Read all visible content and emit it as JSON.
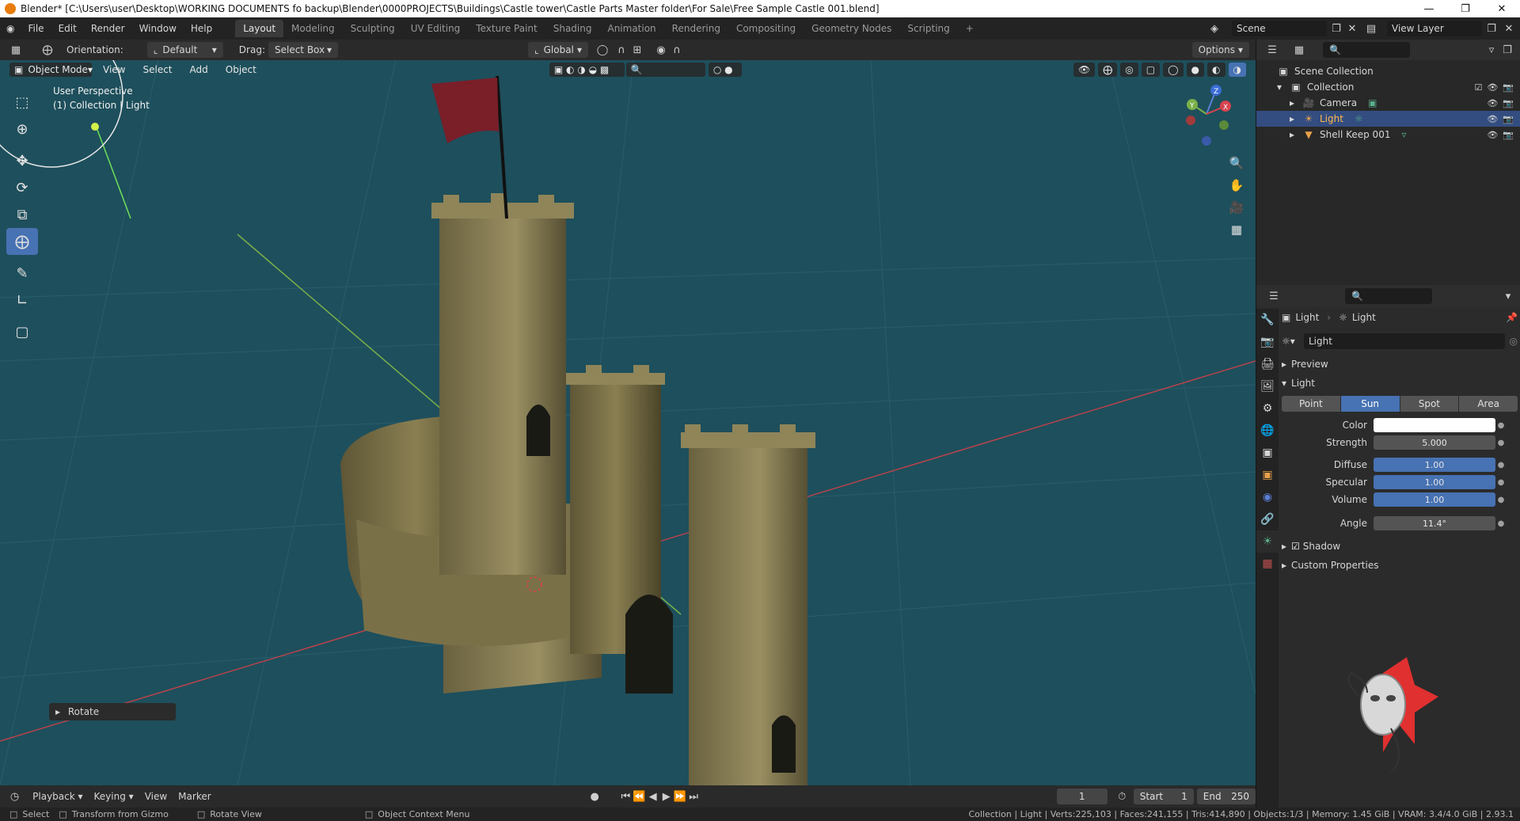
{
  "window": {
    "title": "Blender* [C:\\Users\\user\\Desktop\\WORKING DOCUMENTS fo backup\\Blender\\0000PROJECTS\\Buildings\\Castle tower\\Castle Parts Master folder\\For Sale\\Free Sample Castle 001.blend]"
  },
  "menu": [
    "File",
    "Edit",
    "Render",
    "Window",
    "Help"
  ],
  "workspaces": [
    "Layout",
    "Modeling",
    "Sculpting",
    "UV Editing",
    "Texture Paint",
    "Shading",
    "Animation",
    "Rendering",
    "Compositing",
    "Geometry Nodes",
    "Scripting"
  ],
  "active_workspace": "Layout",
  "scene": {
    "name": "Scene",
    "view_layer": "View Layer"
  },
  "header": {
    "orientation_label": "Orientation:",
    "orientation_value": "Default",
    "drag_label": "Drag:",
    "drag_value": "Select Box",
    "transform_orientation": "Global",
    "options": "Options"
  },
  "viewport": {
    "mode": "Object Mode",
    "menus": [
      "View",
      "Select",
      "Add",
      "Object"
    ],
    "info_line1": "User Perspective",
    "info_line2": "(1) Collection | Light",
    "gizmo_axes": [
      "Z",
      "Y",
      "X"
    ],
    "last_op": "Rotate"
  },
  "timeline": {
    "playback": "Playback",
    "keying": "Keying",
    "view": "View",
    "marker": "Marker",
    "current_frame": "1",
    "start_label": "Start",
    "start": "1",
    "end_label": "End",
    "end": "250"
  },
  "statusbar": {
    "select": "Select",
    "transform": "Transform from Gizmo",
    "rotate_view": "Rotate View",
    "context_menu": "Object Context Menu",
    "stats": "Collection | Light | Verts:225,103 | Faces:241,155 | Tris:414,890 | Objects:1/3 | Memory: 1.45 GiB | VRAM: 3.4/4.0 GiB | 2.93.1"
  },
  "outliner": {
    "scene_collection": "Scene Collection",
    "collection": "Collection",
    "items": [
      {
        "name": "Camera",
        "icon": "camera-icon",
        "color": "#e8a14a"
      },
      {
        "name": "Light",
        "icon": "light-icon",
        "color": "#e8a14a"
      },
      {
        "name": "Shell Keep 001",
        "icon": "mesh-icon",
        "color": "#e8a14a"
      }
    ]
  },
  "properties": {
    "breadcrumb_object": "Light",
    "breadcrumb_data": "Light",
    "datablock_name": "Light",
    "preview_section": "Preview",
    "light_section": "Light",
    "light_types": [
      "Point",
      "Sun",
      "Spot",
      "Area"
    ],
    "active_type": "Sun",
    "fields": {
      "color_label": "Color",
      "strength_label": "Strength",
      "strength": "5.000",
      "diffuse_label": "Diffuse",
      "diffuse": "1.00",
      "specular_label": "Specular",
      "specular": "1.00",
      "volume_label": "Volume",
      "volume": "1.00",
      "angle_label": "Angle",
      "angle": "11.4°"
    },
    "shadow_section": "Shadow",
    "custom_props_section": "Custom Properties"
  },
  "colors": {
    "viewport_bg": "#1e4f5c",
    "accent": "#4772b3",
    "selected_row": "#334d80"
  }
}
